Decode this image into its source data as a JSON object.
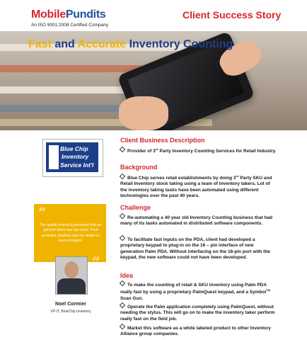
{
  "header": {
    "logo_part1": "Mobile",
    "logo_part2": "Pundits",
    "certification": "An ISO 9001:2008 Certified Company",
    "story_type": "Client Success Story"
  },
  "headline": {
    "word1": "Fast",
    "word2": " and ",
    "word3": "Accurate",
    "word4": " Inventory Counting"
  },
  "client_logo": {
    "line1": "Blue Chip",
    "line2": "Inventory",
    "line3": "Service Int'l"
  },
  "testimonial": {
    "quote": "The quality of work & personnel that we got from them was top notch. Their proactive solutions met our needs on every occasion.",
    "name": "Noel Cormier",
    "title": "VP-IT, BlueChip Inventory"
  },
  "sections": {
    "client_business_description": {
      "heading": "Client Business Description",
      "item1_pre": "Provider of 3",
      "item1_sup": "rd",
      "item1_post": " Party Inventory Counting Services for Retail Industry."
    },
    "background": {
      "heading": "Background",
      "item1_pre": "Blue Chip serves retail establishments by doing 3",
      "item1_sup": "rd",
      "item1_post": " Party SKU and Retail Inventory stock taking using a team of Inventory takers. Lot of the inventory taking tasks have been automated using different technologies over the past 40 years."
    },
    "challenge": {
      "heading": "Challenge",
      "item1": "Re-automating a 40 year old Inventory Counting business that had many of its tasks automated in distributed software components.",
      "item2": "To facilitate fast inputs on the PDA, client had developed a proprietary keypad to plug-in on the 16 – pin interface of new generation Palm PDA. Without interfacing on the 16-pin port with the keypad, the new software could not have been developed."
    },
    "idea": {
      "heading": "Idea",
      "item1_pre": "To make the counting of retail & SKU inventory using Palm PDA really fast by using a proprietary PalmQuest keypad, and a Symbol",
      "item1_sup": "TM",
      "item1_post": " Scan Gun.",
      "item2": "Operate the Palm application completely using PalmQuest, without needing the stylus. This will go on to make the inventory taker perform really fast on the field job.",
      "item3": "Market this software as a white labeled product to other Inventory Alliance group companies."
    }
  },
  "colors": {
    "brand_red": "#d7262e",
    "brand_blue": "#1f3f85",
    "accent_yellow": "#f0b400"
  }
}
